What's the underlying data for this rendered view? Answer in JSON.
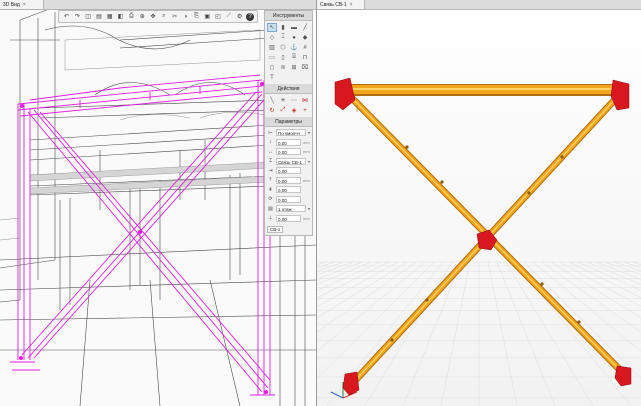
{
  "left_view": {
    "tab_title": "3D Вид",
    "toolbar_icons": [
      "undo-icon",
      "redo-icon",
      "view-cube-icon",
      "layers-icon",
      "calendar-icon",
      "section-icon",
      "print-icon",
      "orbit-icon",
      "pan-icon",
      "zoom-icon",
      "cut-icon",
      "display-style-icon",
      "copy-icon",
      "paste-icon",
      "object-icon",
      "measure-icon",
      "settings-icon",
      "help-icon"
    ],
    "help_glyph": "?"
  },
  "tool_panel": {
    "tools_title": "Инструменты",
    "tool_icons": [
      "select-icon",
      "column-icon",
      "beam-icon",
      "brace-icon",
      "plate-icon",
      "profile-icon",
      "bolt-icon",
      "weld-icon",
      "stiffener-icon",
      "connection-icon",
      "anchor-icon",
      "grid-icon",
      "slab-icon",
      "wall-icon",
      "stair-icon",
      "railing-icon",
      "opening-icon",
      "rebar-icon",
      "mesh-icon",
      "clip-icon",
      "text-icon"
    ],
    "actions_title": "Действия",
    "action_icons": [
      "line-icon",
      "point-icon",
      "offset-icon",
      "trim-icon",
      "rotate-icon",
      "add-node-icon",
      "remove-node-icon",
      "plus-icon"
    ],
    "params_title": "Параметры",
    "params": [
      {
        "icon": "alignment-icon",
        "value": "По умолчч",
        "unit": "",
        "dropdown": true
      },
      {
        "icon": "height-icon",
        "value": "0,00",
        "unit": "mm",
        "dropdown": false
      },
      {
        "icon": "width-icon",
        "value": "0,00",
        "unit": "mm",
        "dropdown": false
      },
      {
        "icon": "profile-type-icon",
        "value": "Связь СВ-1",
        "unit": "",
        "dropdown": true
      },
      {
        "icon": "offset-x-icon",
        "value": "0,00",
        "unit": "",
        "dropdown": false
      },
      {
        "icon": "offset-y-icon",
        "value": "0,00",
        "unit": "mm",
        "dropdown": false
      },
      {
        "icon": "offset-z-icon",
        "value": "0,00",
        "unit": "",
        "dropdown": false
      },
      {
        "icon": "rotation-icon",
        "value": "0,00",
        "unit": "",
        "dropdown": false
      },
      {
        "icon": "floor-icon",
        "value": "1 этаж",
        "unit": "",
        "dropdown": true
      },
      {
        "icon": "elevation-icon",
        "value": "0,00",
        "unit": "mm",
        "dropdown": false
      }
    ],
    "chip_label": "СВ-1"
  },
  "right_view": {
    "tab_title": "Связь СВ-1",
    "colors": {
      "brace": "#f2a61c",
      "connection": "#d8181e",
      "grid": "#dedede",
      "gusset": "#e8202a"
    }
  }
}
